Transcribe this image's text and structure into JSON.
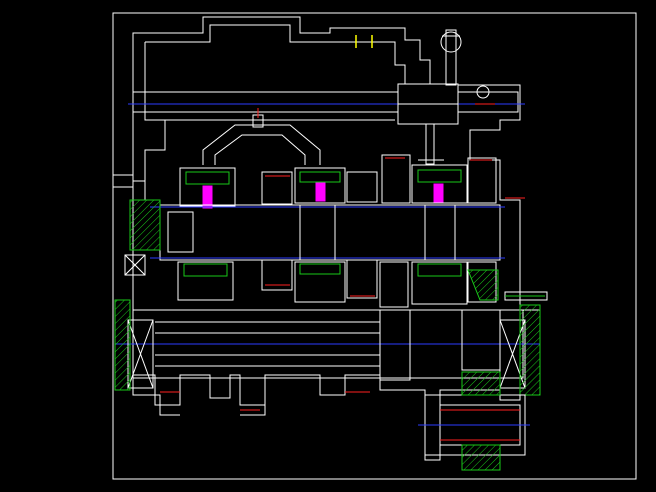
{
  "drawing": {
    "background": "#000000",
    "colors": {
      "outline": "#ffffff",
      "centerline": "#2c3cff",
      "accent_red": "#ff2020",
      "hatch": "#19c819",
      "highlight": "#ff00ff",
      "marker": "#ffff00"
    }
  }
}
